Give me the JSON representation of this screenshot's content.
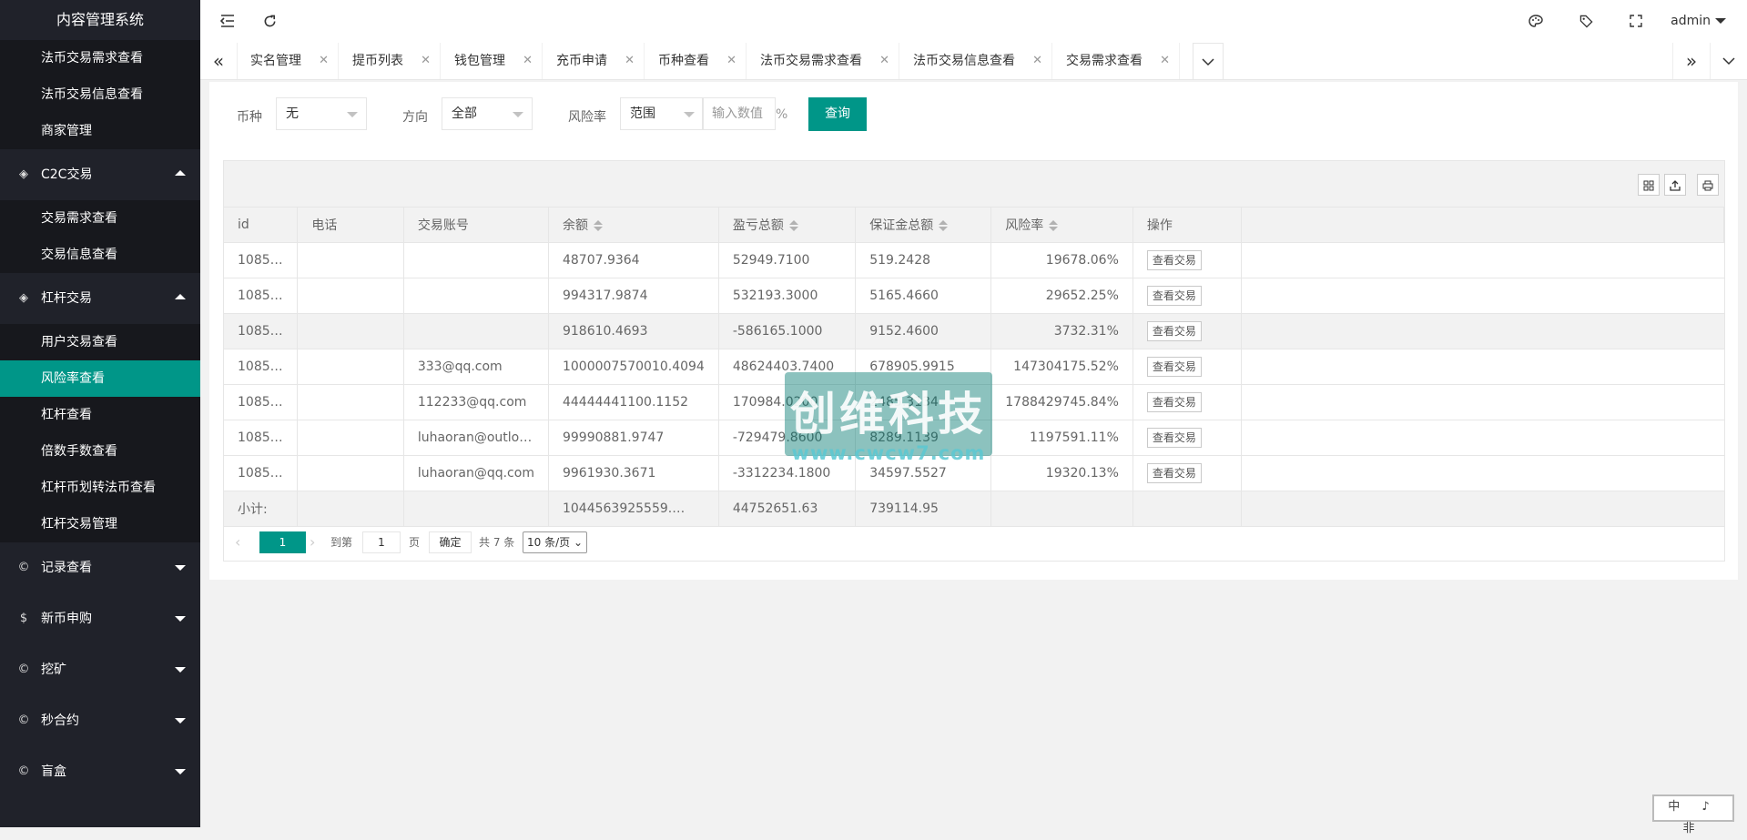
{
  "app_title": "内容管理系统",
  "sidebar": {
    "top_items": [
      "法币交易需求查看",
      "法币交易信息查看",
      "商家管理"
    ],
    "c2c": {
      "label": "C2C交易",
      "items": [
        "交易需求查看",
        "交易信息查看"
      ]
    },
    "leverage": {
      "label": "杠杆交易",
      "items": [
        "用户交易查看",
        "风险率查看",
        "杠杆查看",
        "倍数手数查看",
        "杠杆币划转法币查看",
        "杠杆交易管理"
      ],
      "active": "风险率查看"
    },
    "groups": [
      "记录查看",
      "新币申购",
      "挖矿",
      "秒合约",
      "盲盒"
    ]
  },
  "header": {
    "user": "admin"
  },
  "tabs": [
    "实名管理",
    "提币列表",
    "钱包管理",
    "充币申请",
    "币种查看",
    "法币交易需求查看",
    "法币交易信息查看",
    "交易需求查看"
  ],
  "filters": {
    "currency_label": "币种",
    "currency_value": "无",
    "direction_label": "方向",
    "direction_value": "全部",
    "risk_label": "风险率",
    "risk_value": "范围",
    "input_placeholder": "输入数值",
    "percent": "%",
    "search_button": "查询"
  },
  "table": {
    "headers": [
      "id",
      "电话",
      "交易账号",
      "余额",
      "盈亏总额",
      "保证金总额",
      "风险率",
      "操作"
    ],
    "action_label": "查看交易",
    "rows": [
      [
        "1085…",
        "",
        "",
        "48707.9364",
        "52949.7100",
        "519.2428",
        "19678.06%"
      ],
      [
        "1085…",
        "",
        "",
        "994317.9874",
        "532193.3000",
        "5165.4660",
        "29652.25%"
      ],
      [
        "1085…",
        "",
        "",
        "918610.4693",
        "-586165.1000",
        "9152.4600",
        "3732.31%"
      ],
      [
        "1085…",
        "",
        "333@qq.com",
        "1000007570010.4094",
        "48624403.7400",
        "678905.9915",
        "147304175.52%"
      ],
      [
        "1085…",
        "",
        "112233@qq.com",
        "44444441100.1152",
        "170984.0200",
        "2485.3134",
        "1788429745.84%"
      ],
      [
        "1085…",
        "",
        "luhaoran@outlo…",
        "99990881.9747",
        "-729479.8600",
        "8289.1139",
        "1197591.11%"
      ],
      [
        "1085…",
        "",
        "luhaoran@qq.com",
        "9961930.3671",
        "-3312234.1800",
        "34597.5527",
        "19320.13%"
      ]
    ],
    "total": [
      "小计:",
      "",
      "",
      "1044563925559.…",
      "44752651.63",
      "739114.95",
      ""
    ]
  },
  "pager": {
    "current": "1",
    "goto_label": "到第",
    "goto_value": "1",
    "page_unit": "页",
    "confirm": "确定",
    "total": "共 7 条",
    "page_size": "10 条/页"
  },
  "watermark": {
    "title": "创维科技",
    "url": "www.cwcw7.com"
  },
  "corner_text": "中 ♪ 非"
}
